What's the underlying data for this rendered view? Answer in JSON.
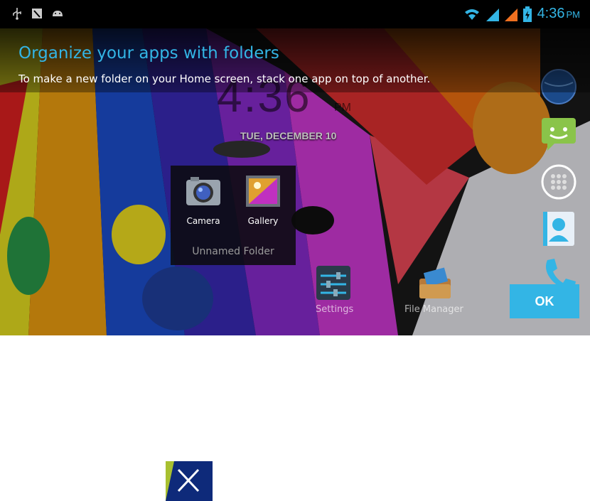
{
  "status_bar": {
    "time": "4:36",
    "ampm": "PM",
    "left_icons": [
      "usb-icon",
      "screenshot-icon",
      "android-icon"
    ],
    "right_icons": [
      "wifi-icon",
      "signal-icon",
      "signal-icon",
      "battery-charging-icon"
    ]
  },
  "home": {
    "clock": "4:36",
    "clock_ampm": "PM",
    "date": "TUE, DECEMBER 10"
  },
  "cling": {
    "title": "Organize your apps with folders",
    "body": "To make a new folder on your Home screen, stack one app on top of another.",
    "ok_label": "OK"
  },
  "folder": {
    "name": "Unnamed Folder",
    "apps": [
      {
        "label": "Camera",
        "icon": "camera-icon"
      },
      {
        "label": "Gallery",
        "icon": "gallery-icon"
      }
    ]
  },
  "workspace_apps": [
    {
      "label": "Settings",
      "icon": "settings-icon"
    },
    {
      "label": "File Manager",
      "icon": "file-manager-icon"
    }
  ],
  "dock_icons": [
    "browser-icon",
    "messaging-icon",
    "all-apps-icon",
    "contacts-icon",
    "phone-icon"
  ],
  "colors": {
    "accent": "#33b5e5",
    "close_box": "#0e2a7a"
  },
  "close_icon": "close-icon"
}
